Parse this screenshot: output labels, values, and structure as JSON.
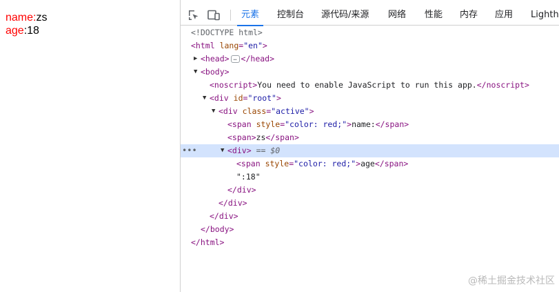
{
  "page": {
    "line1": {
      "label": "name:",
      "value": "zs"
    },
    "line2": {
      "label": "age",
      "value": ":18"
    },
    "label_color": "#ff0000"
  },
  "devtools": {
    "icons": [
      "inspect-element-icon",
      "device-toolbar-icon"
    ],
    "tabs": [
      "元素",
      "控制台",
      "源代码/来源",
      "网络",
      "性能",
      "内存",
      "应用",
      "Lighthouse"
    ],
    "active_tab": "元素",
    "accent_color": "#1a73e8"
  },
  "dom": {
    "doctype": "<!DOCTYPE html>",
    "html_open": {
      "tag": "<html",
      "attr": "lang",
      "val": "\"en\"",
      "close": ">"
    },
    "head": {
      "open": "<head>",
      "ellipsis": "…",
      "close": "</head>"
    },
    "body_open": "<body>",
    "noscript": {
      "open": "<noscript>",
      "text": "You need to enable JavaScript to run this app.",
      "close": "</noscript>"
    },
    "root_div": {
      "tag": "<div",
      "attr": "id",
      "val": "\"root\"",
      "close": ">"
    },
    "active_div": {
      "tag": "<div",
      "attr": "class",
      "val": "\"active\"",
      "close": ">"
    },
    "span1": {
      "tag": "<span",
      "attr": "style",
      "val": "\"color: red;\"",
      "close": ">",
      "text": "name:",
      "end": "</span>"
    },
    "span2": {
      "open": "<span>",
      "text": "zs",
      "close": "</span>"
    },
    "selected_div": {
      "open": "<div>",
      "marker": "== $0",
      "dots": "•••"
    },
    "span3": {
      "tag": "<span",
      "attr": "style",
      "val": "\"color: red;\"",
      "close": ">",
      "text": "age",
      "end": "</span>"
    },
    "text_node": "\":18\"",
    "close_div": "</div>",
    "close_body": "</body>",
    "close_html": "</html>"
  },
  "watermark": "@稀土掘金技术社区"
}
